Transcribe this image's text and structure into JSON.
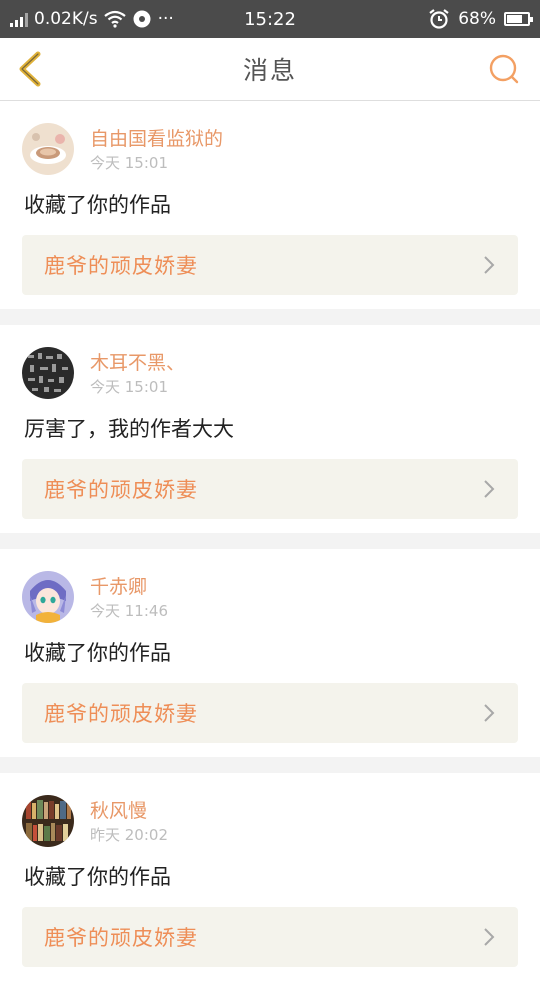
{
  "status_bar": {
    "net_speed": "0.02K/s",
    "time": "15:22",
    "battery": "68%",
    "battery_level": 0.68,
    "more": "···"
  },
  "header": {
    "title": "消息"
  },
  "messages": [
    {
      "username": "自由国看监狱的",
      "time": "今天 15:01",
      "text": "收藏了你的作品",
      "work_title": "鹿爷的顽皮娇妻"
    },
    {
      "username": "木耳不黑、",
      "time": "今天 15:01",
      "text": "厉害了，我的作者大大",
      "work_title": "鹿爷的顽皮娇妻"
    },
    {
      "username": "千赤卿",
      "time": "今天 11:46",
      "text": "收藏了你的作品",
      "work_title": "鹿爷的顽皮娇妻"
    },
    {
      "username": "秋风慢",
      "time": "昨天 20:02",
      "text": "收藏了你的作品",
      "work_title": "鹿爷的顽皮娇妻"
    }
  ],
  "colors": {
    "accent": "#ee8e57",
    "username": "#e89868",
    "header_icon": "#f3a063",
    "back_icon": "#e0b23a",
    "statusbar_bg": "#4b4b4b"
  },
  "icons": {
    "back": "chevron-left-icon",
    "search": "search-icon",
    "item_arrow": "chevron-right-icon"
  }
}
